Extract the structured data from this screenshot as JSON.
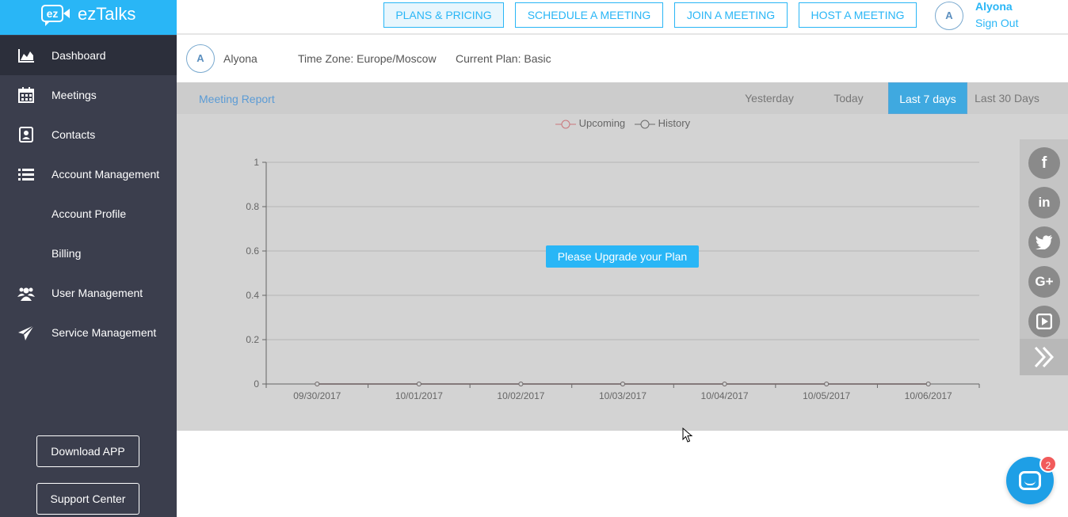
{
  "app": {
    "logo_badge": "ez",
    "name": "ezTalks"
  },
  "sidebar": {
    "items": [
      {
        "label": "Dashboard",
        "icon": "area-chart-icon"
      },
      {
        "label": "Meetings",
        "icon": "calendar-icon"
      },
      {
        "label": "Contacts",
        "icon": "contact-book-icon"
      },
      {
        "label": "Account Management",
        "icon": "list-icon"
      },
      {
        "label": "Account Profile"
      },
      {
        "label": "Billing"
      },
      {
        "label": "User Management",
        "icon": "users-icon"
      },
      {
        "label": "Service Management",
        "icon": "paper-plane-icon"
      }
    ],
    "download_app": "Download APP",
    "support_center": "Support Center"
  },
  "header": {
    "plans": "PLANS & PRICING",
    "schedule": "SCHEDULE A MEETING",
    "join": "JOIN A MEETING",
    "host": "HOST A MEETING",
    "avatar_initial": "A",
    "user_name": "Alyona",
    "sign_out": "Sign Out"
  },
  "user_info": {
    "avatar_initial": "A",
    "name": "Alyona",
    "timezone": "Time Zone: Europe/Moscow",
    "plan": "Current Plan: Basic"
  },
  "report": {
    "title": "Meeting Report",
    "tabs": [
      "Yesterday",
      "Today",
      "Last 7 days",
      "Last 30 Days"
    ],
    "active_tab": "Last 7 days",
    "upgrade_label": "Please Upgrade your Plan"
  },
  "chart_data": {
    "type": "line",
    "categories": [
      "09/30/2017",
      "10/01/2017",
      "10/02/2017",
      "10/03/2017",
      "10/04/2017",
      "10/05/2017",
      "10/06/2017"
    ],
    "series": [
      {
        "name": "Upcoming",
        "values": [
          0,
          0,
          0,
          0,
          0,
          0,
          0
        ],
        "color": "#c9767b"
      },
      {
        "name": "History",
        "values": [
          0,
          0,
          0,
          0,
          0,
          0,
          0
        ],
        "color": "#6b6b6b"
      }
    ],
    "yticks": [
      "0",
      "0.2",
      "0.4",
      "0.6",
      "0.8",
      "1"
    ],
    "ylim": [
      0,
      1
    ],
    "grid": true,
    "legend": "top-center"
  },
  "social": [
    "facebook-icon",
    "linkedin-icon",
    "twitter-icon",
    "google-plus-icon",
    "video-icon"
  ],
  "chat": {
    "badge_count": "2"
  },
  "colors": {
    "accent": "#29b6f6",
    "sidebar": "#3b3e4d",
    "active_tab": "#3fa9e0"
  }
}
